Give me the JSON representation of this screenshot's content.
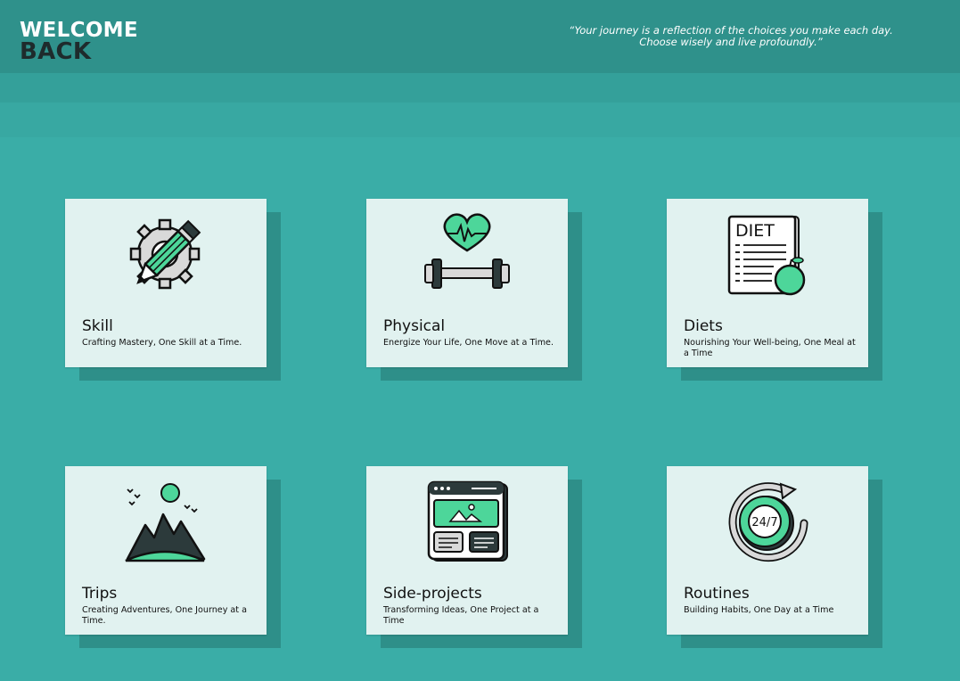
{
  "header": {
    "welcome_line1": "WELCOME",
    "welcome_line2": "BACK",
    "quote_line1": "“Your journey is a reflection of the choices you make each day.",
    "quote_line2": "Choose wisely and live profoundly.”"
  },
  "colors": {
    "background": "#3aada7",
    "header": "#2f918b",
    "card": "#e1f2f0",
    "card_shadow": "#2e8f89",
    "accent_green": "#4dd69a",
    "dark": "#2c3a3b"
  },
  "cards": [
    {
      "title": "Skill",
      "subtitle": "Crafting Mastery, One Skill at a Time.",
      "icon": "pencil-gear-icon"
    },
    {
      "title": "Physical",
      "subtitle": "Energize Your Life, One Move at a Time.",
      "icon": "heart-dumbbell-icon"
    },
    {
      "title": "Diets",
      "subtitle": "Nourishing Your Well-being, One Meal at a Time",
      "icon": "diet-apple-icon",
      "icon_label": "DIET"
    },
    {
      "title": "Trips",
      "subtitle": "Creating Adventures, One Journey at a Time.",
      "icon": "mountain-sun-icon"
    },
    {
      "title": "Side-projects",
      "subtitle": "Transforming Ideas, One Project at a Time",
      "icon": "browser-window-icon"
    },
    {
      "title": "Routines",
      "subtitle": "Building Habits, One Day at a Time",
      "icon": "clock-24-7-icon",
      "icon_label": "24/7"
    }
  ]
}
